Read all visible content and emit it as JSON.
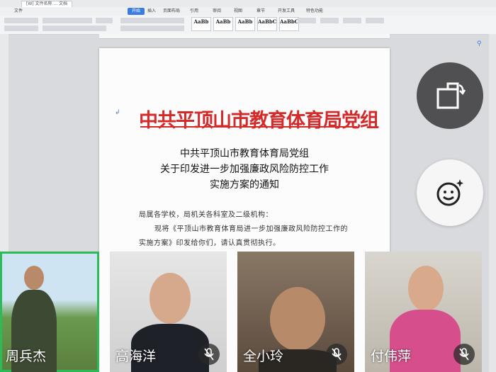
{
  "document_tab": "[W] 文件名称 ... 文档",
  "menu": {
    "items": [
      "文件",
      "开始",
      "插入",
      "页面布局",
      "引用",
      "审阅",
      "视图",
      "章节",
      "开发工具",
      "特色功能"
    ],
    "active_index": 1
  },
  "ribbon": {
    "styles": [
      "AaBb",
      "AaBb",
      "AaBb",
      "AaBbC",
      "AaBbC"
    ]
  },
  "document": {
    "red_header": "中共平顶山市教育体育局党组",
    "title_lines": [
      "中共平顶山市教育体育局党组",
      "关于印发进一步加强廉政风险防控工作",
      "实施方案的通知"
    ],
    "salutation": "局属各学校，局机关各科室及二级机构：",
    "body_lines": [
      "现将《平顶山市教育体育局进一步加强廉政风险防控工作的",
      "实施方案》印发给你们，请认真贯彻执行。"
    ]
  },
  "controls": {
    "rotate_icon": "rotate-screen-icon",
    "effects_icon": "face-sparkle-icon"
  },
  "participants": [
    {
      "name": "周兵杰",
      "muted": false,
      "active": true
    },
    {
      "name": "高海洋",
      "muted": true,
      "active": false
    },
    {
      "name": "全小玲",
      "muted": true,
      "active": false
    },
    {
      "name": "付伟萍",
      "muted": true,
      "active": false
    }
  ],
  "colors": {
    "red_header": "#d42a2a",
    "active_speaker": "#2dbb57",
    "accent": "#3a7de0"
  }
}
